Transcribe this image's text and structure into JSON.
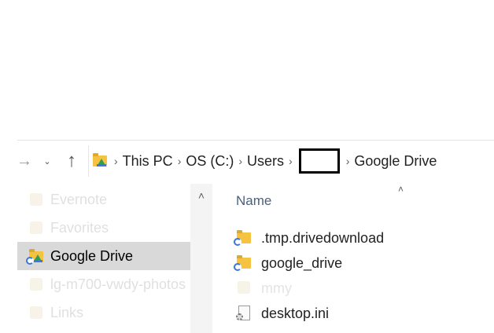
{
  "breadcrumb": {
    "items": [
      "This PC",
      "OS (C:)",
      "Users",
      "Google Drive"
    ],
    "separator": "›"
  },
  "nav": {
    "back_icon": "→",
    "recent_icon": "⌄",
    "up_icon": "↑",
    "scroll_up_icon": "˄",
    "sort_icon": "˄"
  },
  "nav_pane": {
    "items": [
      {
        "label": "Evernote",
        "state": "faded"
      },
      {
        "label": "Favorites",
        "state": "faded"
      },
      {
        "label": "Google Drive",
        "state": "selected"
      },
      {
        "label": "lg-m700-vwdy-photos",
        "state": "faded"
      },
      {
        "label": "Links",
        "state": "faded"
      }
    ]
  },
  "files": {
    "column_header": "Name",
    "items": [
      {
        "label": ".tmp.drivedownload",
        "type": "sync-folder"
      },
      {
        "label": "google_drive",
        "type": "sync-folder"
      },
      {
        "label": "mmy",
        "type": "faded"
      },
      {
        "label": "desktop.ini",
        "type": "config-file"
      }
    ]
  },
  "colors": {
    "selected_bg": "#d9d9d9",
    "folder": "#f5c242",
    "header_text": "#4c6079"
  }
}
